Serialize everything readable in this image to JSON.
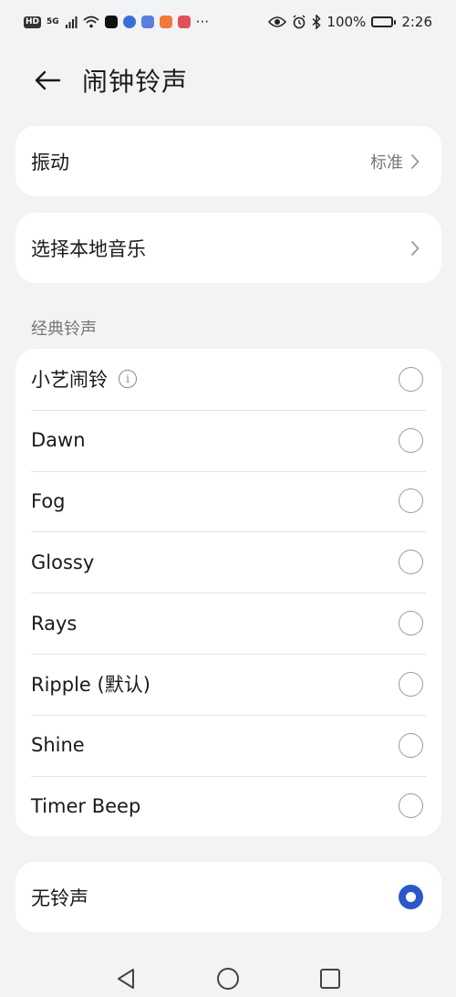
{
  "status_bar": {
    "hd": "HD",
    "signal": "5G",
    "more": "···",
    "battery": "100%",
    "time": "2:26"
  },
  "header": {
    "title": "闹钟铃声"
  },
  "vibration": {
    "label": "振动",
    "value": "标准"
  },
  "local_music": {
    "label": "选择本地音乐"
  },
  "classic_section": {
    "title": "经典铃声",
    "items": [
      {
        "label": "小艺闹铃",
        "selected": false
      },
      {
        "label": "Dawn",
        "selected": false
      },
      {
        "label": "Fog",
        "selected": false
      },
      {
        "label": "Glossy",
        "selected": false
      },
      {
        "label": "Rays",
        "selected": false
      },
      {
        "label": "Ripple (默认)",
        "selected": false
      },
      {
        "label": "Shine",
        "selected": false
      },
      {
        "label": "Timer Beep",
        "selected": false
      }
    ]
  },
  "no_ringtone": {
    "label": "无铃声",
    "selected": true
  },
  "colors": {
    "accent": "#2a58c9",
    "background": "#f1f3f5",
    "card": "#ffffff"
  }
}
